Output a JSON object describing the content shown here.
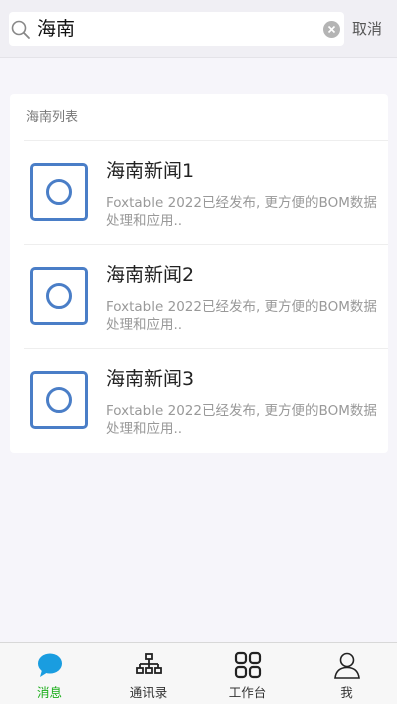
{
  "search": {
    "query": "海南",
    "cancel_label": "取消"
  },
  "list": {
    "header": "海南列表",
    "items": [
      {
        "title": "海南新闻1",
        "desc": "Foxtable 2022已经发布, 更方便的BOM数据处理和应用.."
      },
      {
        "title": "海南新闻2",
        "desc": "Foxtable 2022已经发布, 更方便的BOM数据处理和应用.."
      },
      {
        "title": "海南新闻3",
        "desc": "Foxtable 2022已经发布, 更方便的BOM数据处理和应用.."
      }
    ]
  },
  "tabbar": {
    "tabs": [
      {
        "label": "消息",
        "icon": "chat-bubble-icon",
        "active": true
      },
      {
        "label": "通讯录",
        "icon": "org-chart-icon",
        "active": false
      },
      {
        "label": "工作台",
        "icon": "grid-icon",
        "active": false
      },
      {
        "label": "我",
        "icon": "person-icon",
        "active": false
      }
    ]
  },
  "colors": {
    "accent": "#1aad19",
    "chat_icon": "#1a9de0",
    "thumb_border": "#4a7ec7",
    "background": "#f6f5fa"
  }
}
